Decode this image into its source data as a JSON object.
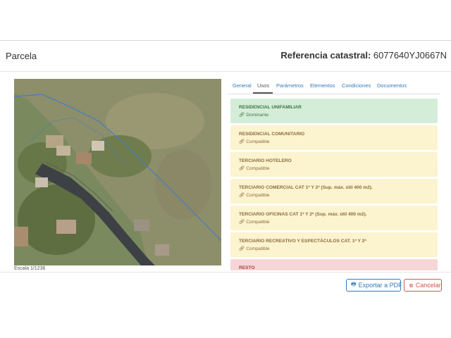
{
  "modal": {
    "title": "Parcela",
    "reference_label": "Referencia catastral:",
    "reference_value": "6077640YJ0667N"
  },
  "map": {
    "scale": "Escala 1/1236"
  },
  "tabs": [
    {
      "label": "General",
      "active": false
    },
    {
      "label": "Usos",
      "active": true
    },
    {
      "label": "Parámetros",
      "active": false
    },
    {
      "label": "Elementos",
      "active": false
    },
    {
      "label": "Condiciones",
      "active": false
    },
    {
      "label": "Documentos",
      "active": false
    }
  ],
  "uses": [
    {
      "name": "RESIDENCIAL UNIFAMILIAR",
      "status": "Dominante",
      "color": "green"
    },
    {
      "name": "RESIDENCIAL COMUNITARIO",
      "status": "Compatible",
      "color": "yellow"
    },
    {
      "name": "TERCIARIO HOTELERO",
      "status": "Compatible",
      "color": "yellow"
    },
    {
      "name": "TERCIARIO COMERCIAL CAT 1ª Y 2ª (Sup. máx. útil 400 m2).",
      "status": "Compatible",
      "color": "yellow"
    },
    {
      "name": "TERCIARIO OFICINAS CAT 1ª Y 2ª (Sup. máx. útil 400 m2).",
      "status": "Compatible",
      "color": "yellow"
    },
    {
      "name": "TERCIARIO RECREATIVO Y ESPECTÁCULOS CAT. 1ª Y 2ª",
      "status": "Compatible",
      "color": "yellow"
    },
    {
      "name": "RESTO",
      "status": "",
      "color": "red"
    }
  ],
  "footer": {
    "export_label": "Exportar a PDF",
    "cancel_label": "Cancelar"
  },
  "colors": {
    "primary": "#337ab7",
    "danger": "#d9534f",
    "success_bg": "#d4edd9",
    "warning_bg": "#fcf3cf",
    "danger_bg": "#f6d6d6"
  }
}
